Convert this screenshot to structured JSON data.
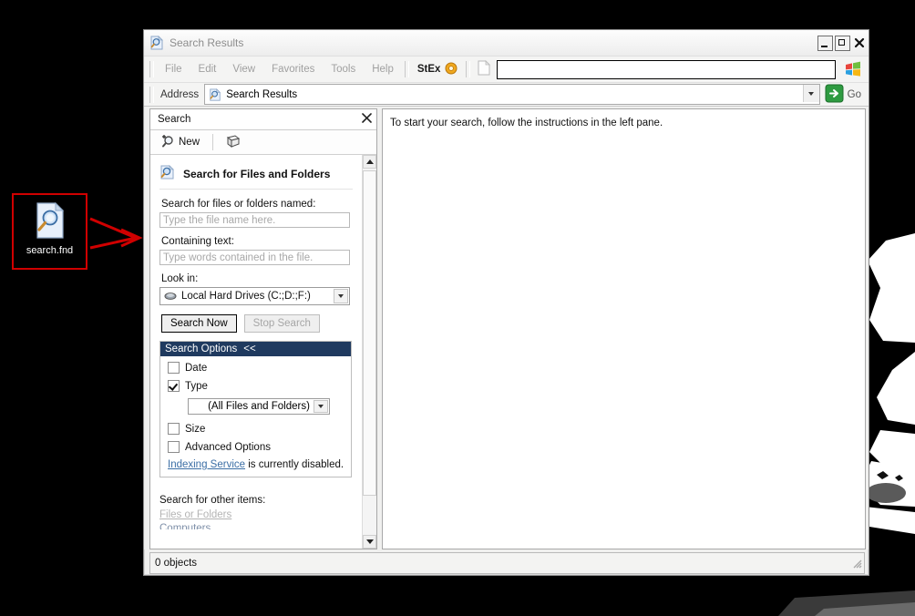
{
  "desktop": {
    "icon": {
      "label": "search.fnd",
      "icon": "search-document-icon"
    },
    "annotation": {
      "box_color": "#d00000",
      "arrow_color": "#d00000"
    }
  },
  "window": {
    "title": "Search Results",
    "title_icon": "search-results-icon",
    "controls": {
      "minimize": "Minimize",
      "maximize": "Maximize",
      "close": "Close"
    },
    "menu": {
      "items": [
        "File",
        "Edit",
        "View",
        "Favorites",
        "Tools",
        "Help"
      ]
    },
    "toolbar": {
      "stex_label": "StEx",
      "stex_icon": "orange-ring-icon",
      "page_icon": "page-icon",
      "search_field_value": "",
      "flag_icon": "windows-flag-icon"
    },
    "address": {
      "label": "Address",
      "value": "Search Results",
      "icon": "search-results-icon",
      "dropdown_icon": "chevron-down-icon",
      "go_label": "Go",
      "go_icon": "green-go-arrow-icon"
    },
    "statusbar": {
      "text": "0 objects"
    }
  },
  "search_pane": {
    "title": "Search",
    "close_icon": "close-icon",
    "toolbar": {
      "new_label": "New",
      "new_icon": "search-sparkle-icon",
      "book_icon": "notebook-icon"
    },
    "heading": "Search for Files and Folders",
    "heading_icon": "search-files-icon",
    "fields": {
      "name_label": "Search for files or folders named:",
      "name_value": "",
      "name_placeholder": "Type the file name here.",
      "text_label": "Containing text:",
      "text_value": "",
      "text_placeholder": "Type words contained in the file.",
      "lookin_label": "Look in:",
      "lookin_value": "Local Hard Drives (C:;D:;F:)",
      "lookin_icon": "hard-drive-icon"
    },
    "buttons": {
      "search_now": "Search Now",
      "stop_search": "Stop Search",
      "stop_search_disabled": true
    },
    "options": {
      "header": "Search Options",
      "header_toggle": "<<",
      "header_color": "#1f3a5f",
      "items": [
        {
          "label": "Date",
          "checked": false
        },
        {
          "label": "Type",
          "checked": true
        },
        {
          "label": "Size",
          "checked": false
        },
        {
          "label": "Advanced Options",
          "checked": false
        }
      ],
      "type_value": "(All Files and Folders)",
      "indexing_link": "Indexing Service",
      "indexing_rest": " is currently disabled."
    },
    "other_items": {
      "heading": "Search for other items:",
      "links": [
        "Files or Folders",
        "Computers"
      ]
    }
  },
  "results_pane": {
    "message": "To start your search, follow the instructions in the left pane."
  }
}
